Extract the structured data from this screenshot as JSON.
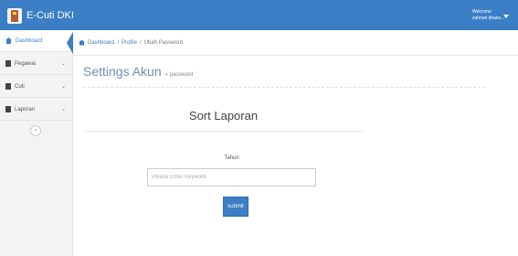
{
  "app": {
    "title": "E-Cuti DKI",
    "user": {
      "greeting": "Welcome",
      "name": "zahrani khairu..."
    }
  },
  "sidebar": {
    "items": [
      {
        "label": "Dashboard",
        "icon": "home-icon"
      },
      {
        "label": "Pegawai",
        "icon": "user-icon"
      },
      {
        "label": "Cuti",
        "icon": "tie-icon"
      },
      {
        "label": "Laporan",
        "icon": "file-icon"
      }
    ],
    "collapse_label": "«"
  },
  "breadcrumb": {
    "items": [
      "Dashboard",
      "Profile",
      "Ubah Password"
    ],
    "separator": "/"
  },
  "page": {
    "title": "Settings Akun",
    "subtitle": "» password"
  },
  "form": {
    "title": "Sort Laporan",
    "field_label": "Tahun",
    "placeholder": "Please Enter Keyword",
    "submit_label": "submit"
  },
  "colors": {
    "accent": "#3b7ec6"
  }
}
